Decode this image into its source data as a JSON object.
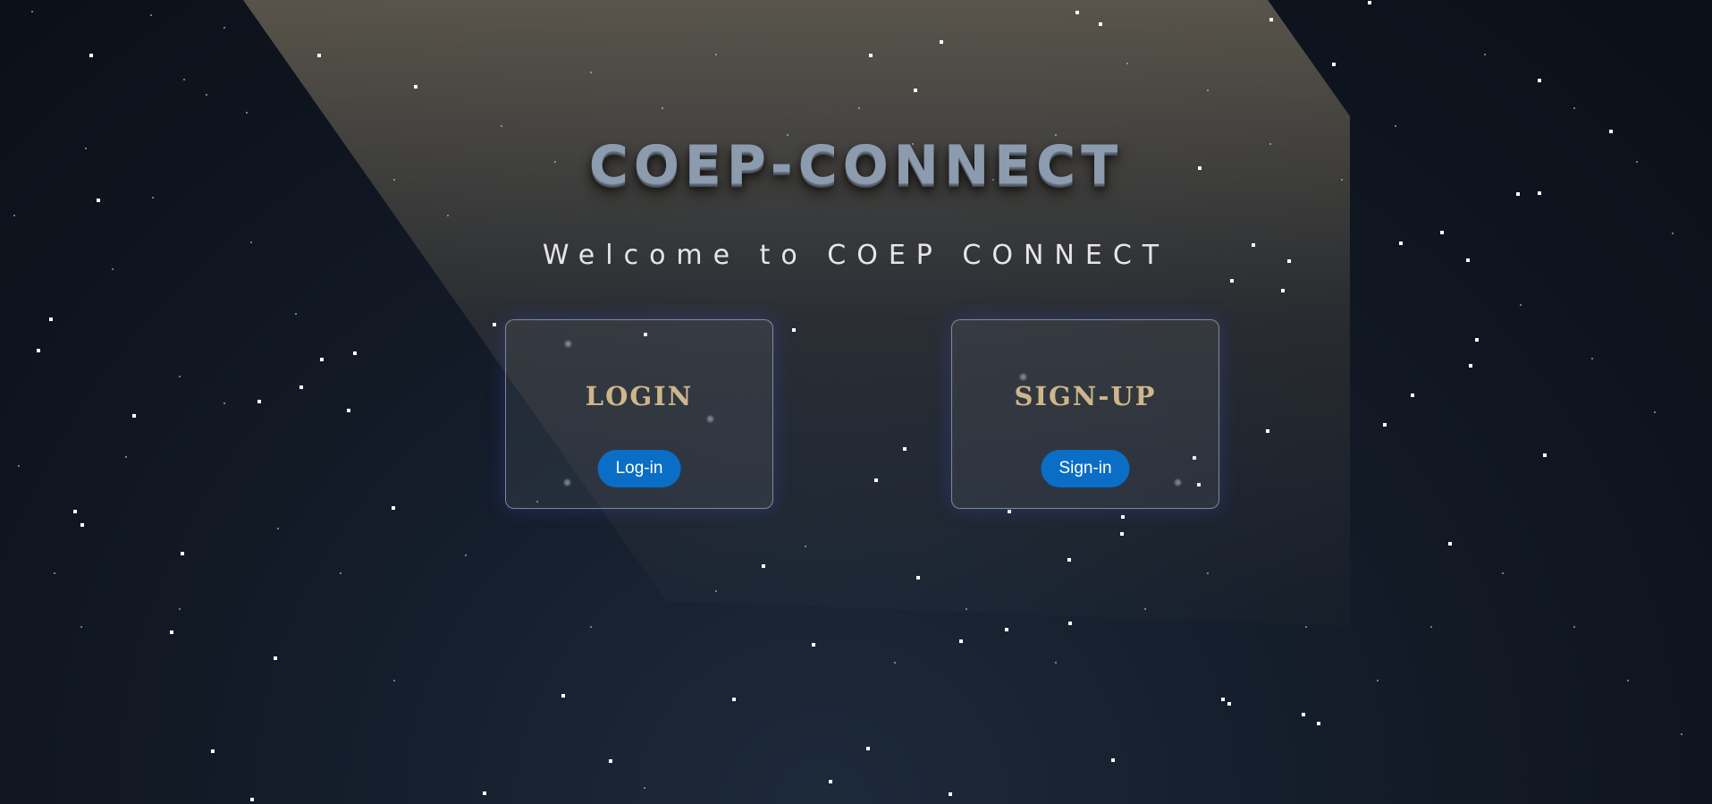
{
  "app": {
    "title": "COEP-CONNECT",
    "welcome": "Welcome to COEP CONNECT"
  },
  "cards": {
    "login": {
      "heading": "LOGIN",
      "button_label": "Log-in"
    },
    "signup": {
      "heading": "SIGN-UP",
      "button_label": "Sign-in"
    }
  },
  "colors": {
    "background": "#0f141d",
    "title": "#8c9bae",
    "card_heading": "#cfb68a",
    "button": "#0a6ec7",
    "button_text": "#ffffff"
  }
}
